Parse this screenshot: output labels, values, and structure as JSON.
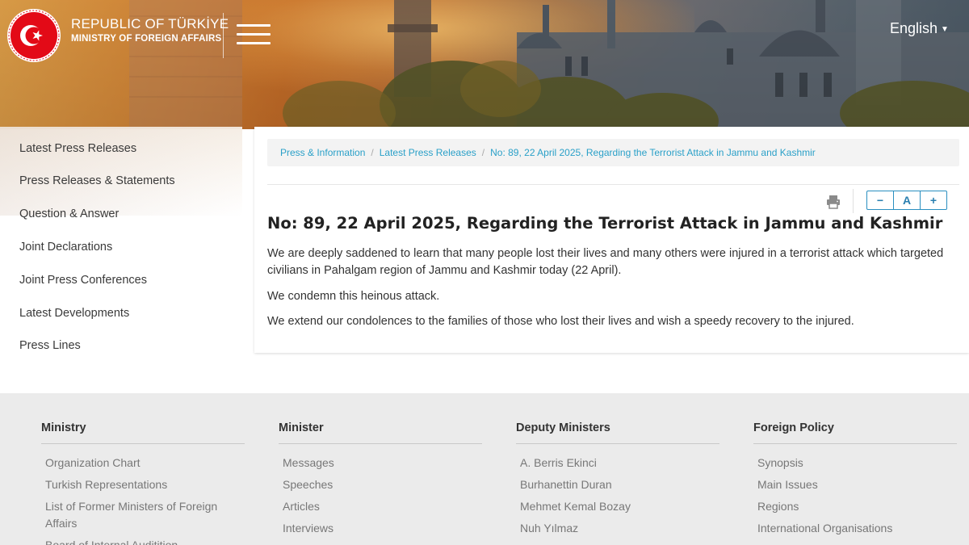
{
  "header": {
    "brand_line1": "REPUBLIC OF TÜRKİYE",
    "brand_line2": "MINISTRY OF FOREIGN AFFAIRS",
    "language": "English",
    "menu_icon": "hamburger-icon",
    "logo_icon": "crescent-star-emblem"
  },
  "sidebar": {
    "items": [
      {
        "label": "Latest Press Releases"
      },
      {
        "label": "Press Releases & Statements"
      },
      {
        "label": "Question & Answer"
      },
      {
        "label": "Joint Declarations"
      },
      {
        "label": "Joint Press Conferences"
      },
      {
        "label": "Latest Developments"
      },
      {
        "label": "Press Lines"
      }
    ]
  },
  "breadcrumb": {
    "items": [
      {
        "label": "Press & Information"
      },
      {
        "label": "Latest Press Releases"
      },
      {
        "label": "No: 89, 22 April 2025, Regarding the Terrorist Attack in Jammu and Kashmir"
      }
    ],
    "separator": "/"
  },
  "tools": {
    "print_icon": "printer-icon",
    "decrease": "−",
    "reset": "A",
    "increase": "+"
  },
  "article": {
    "title": "No: 89, 22 April 2025, Regarding the Terrorist Attack in Jammu and Kashmir",
    "paragraphs": [
      "We are deeply saddened to learn that many people lost their lives and many others were injured in a terrorist attack which targeted civilians in Pahalgam region of Jammu and Kashmir today (22 April).",
      "We condemn this heinous attack.",
      "We extend our condolences to the families of those who lost their lives and wish a speedy recovery to the injured."
    ]
  },
  "footer": {
    "columns": [
      {
        "heading": "Ministry",
        "links": [
          "Organization Chart",
          "Turkish Representations",
          "List of Former Ministers of Foreign Affairs",
          "Board of Internal Auditition"
        ]
      },
      {
        "heading": "Minister",
        "links": [
          "Messages",
          "Speeches",
          "Articles",
          "Interviews"
        ]
      },
      {
        "heading": "Deputy Ministers",
        "links": [
          "A. Berris Ekinci",
          "Burhanettin Duran",
          "Mehmet Kemal Bozay",
          "Nuh Yılmaz"
        ]
      },
      {
        "heading": "Foreign Policy",
        "links": [
          "Synopsis",
          "Main Issues",
          "Regions",
          "International Organisations"
        ]
      }
    ]
  },
  "colors": {
    "accent": "#2aa0c8",
    "emblem_red": "#e30a17",
    "footer_bg": "#ebebeb"
  }
}
